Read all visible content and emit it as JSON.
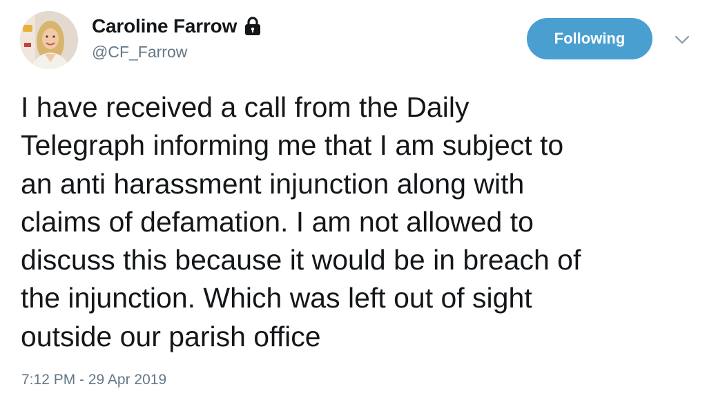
{
  "author": {
    "display_name": "Caroline Farrow",
    "handle": "@CF_Farrow",
    "avatar_icon": "profile-photo",
    "protected_icon": "lock-icon"
  },
  "actions": {
    "follow_label": "Following",
    "menu_icon": "chevron-down-icon"
  },
  "tweet": {
    "text": "I have received a call from the Daily\nTelegraph informing me that I am subject to\nan anti harassment injunction along with\nclaims of defamation. I am not allowed to\ndiscuss this because it would be in breach of\nthe injunction. Which was left out of sight\noutside our parish office",
    "timestamp": "7:12 PM - 29 Apr 2019"
  },
  "colors": {
    "follow_button_bg": "#4a9fd1",
    "secondary_text": "#657786",
    "primary_text": "#14171a"
  }
}
